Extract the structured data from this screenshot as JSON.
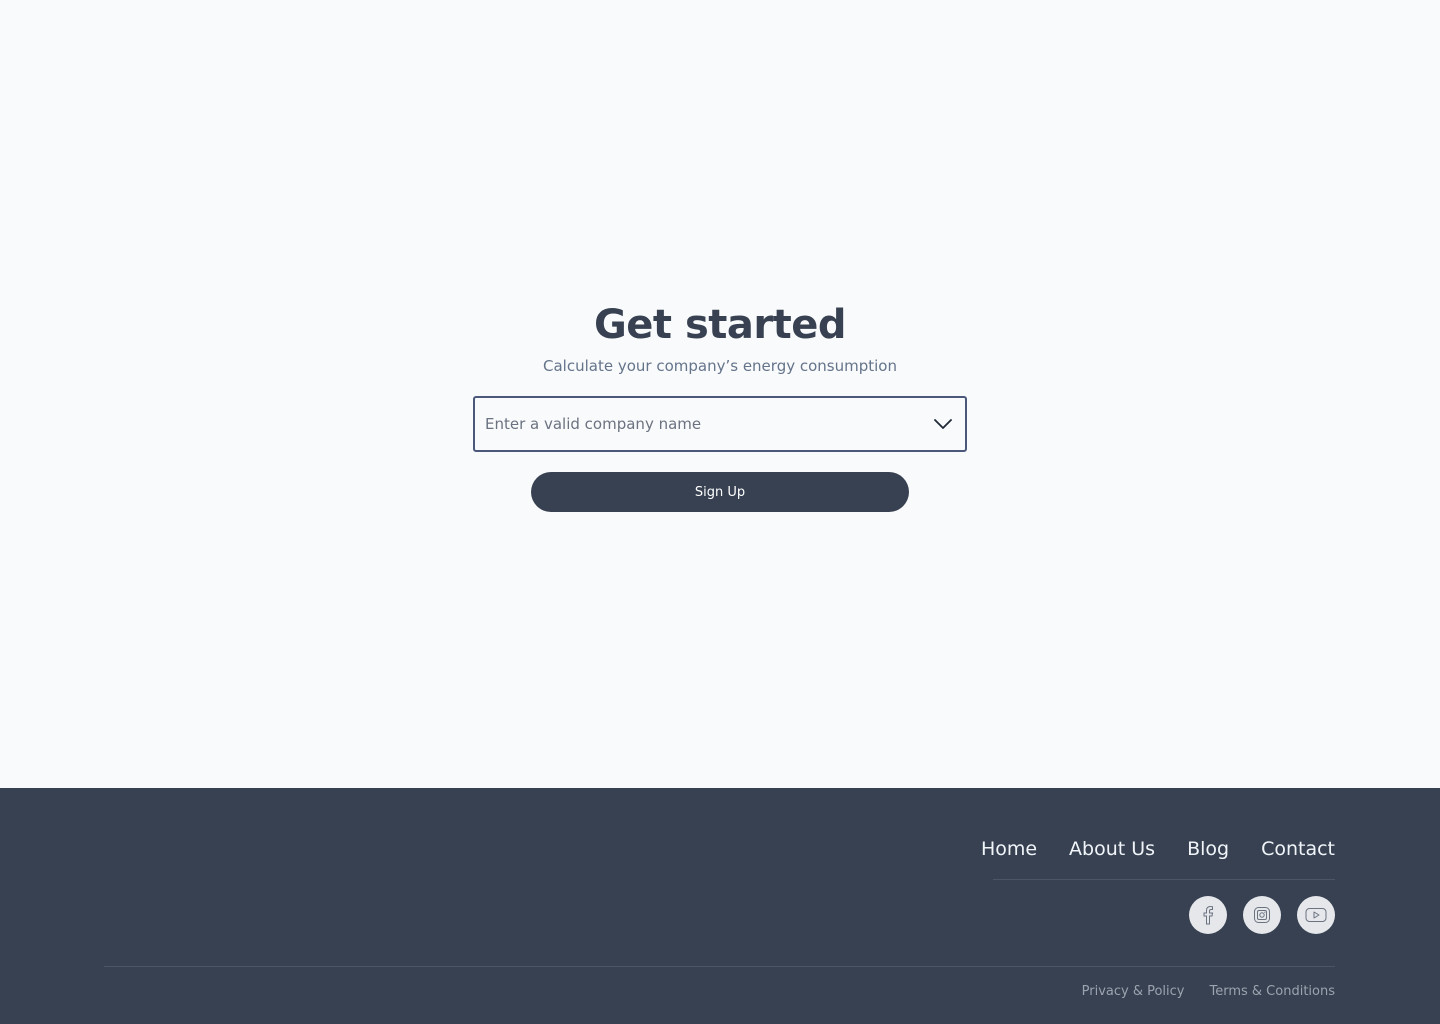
{
  "hero": {
    "title": "Get started",
    "subtitle": "Calculate your company’s energy consumption"
  },
  "company_select": {
    "placeholder": "Enter a valid company name",
    "value": "",
    "icon": "chevron-down-icon"
  },
  "signup": {
    "label": "Sign Up"
  },
  "footer": {
    "nav": [
      {
        "label": "Home"
      },
      {
        "label": "About Us"
      },
      {
        "label": "Blog"
      },
      {
        "label": "Contact"
      }
    ],
    "social": [
      {
        "icon": "facebook-icon"
      },
      {
        "icon": "instagram-icon"
      },
      {
        "icon": "youtube-icon"
      }
    ],
    "legal": [
      {
        "label": "Privacy & Policy"
      },
      {
        "label": "Terms & Conditions"
      }
    ]
  },
  "colors": {
    "background": "#f9fafb",
    "primary": "#374151",
    "subtitle": "#64748b",
    "input_border": "#4b5879",
    "social_circle": "#e5e7eb"
  }
}
